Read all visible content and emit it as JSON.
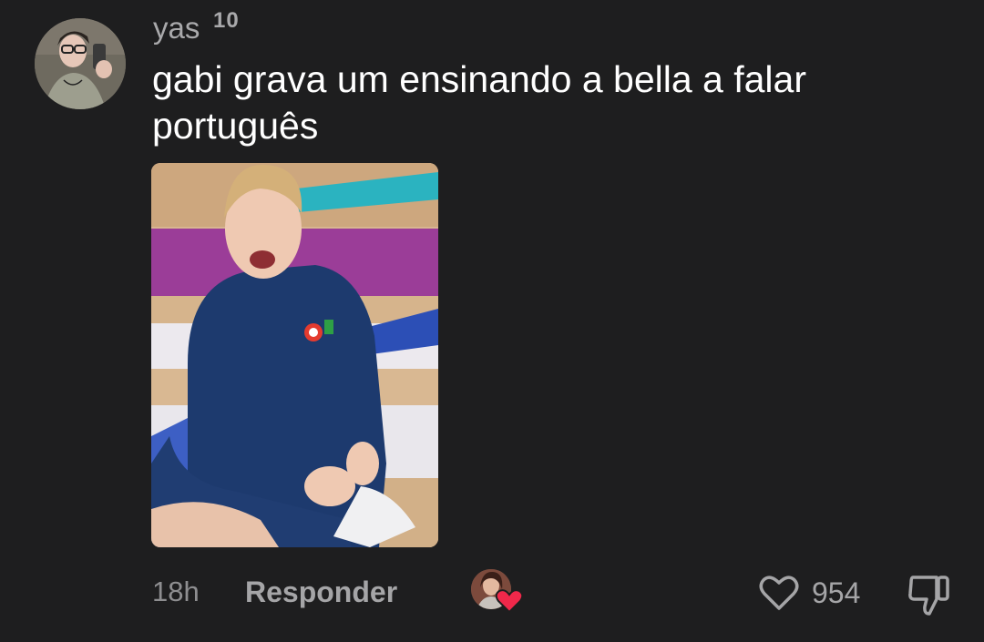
{
  "comment": {
    "username": "yas",
    "username_badge": "10",
    "text": "gabi grava um ensinando a bella a falar português",
    "avatar_icon": "user-avatar",
    "photo_icon": "attached-photo"
  },
  "actions": {
    "timestamp": "18h",
    "reply_label": "Responder",
    "like_count": "954",
    "creator_liked_icon": "creator-avatar-with-heart",
    "like_icon": "heart-outline-icon",
    "dislike_icon": "thumbs-down-icon"
  },
  "colors": {
    "background": "#1e1e1f",
    "text_primary": "#ffffff",
    "text_secondary": "#a5a5a7",
    "heart_red": "#f0284a"
  }
}
